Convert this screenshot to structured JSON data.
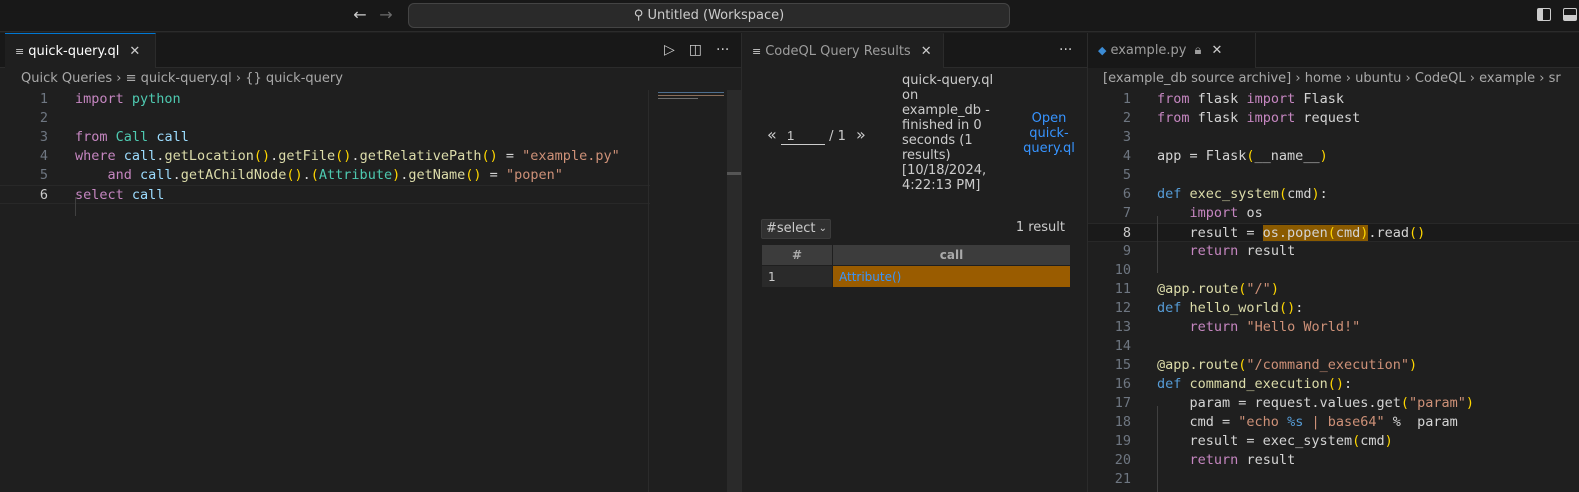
{
  "titlebar": {
    "back_icon": "arrow-left-icon",
    "forward_icon": "arrow-right-icon",
    "search_icon": "search-icon",
    "workspace_title": "Untitled (Workspace)"
  },
  "left_editor": {
    "tab_label": "quick-query.ql",
    "breadcrumb": [
      "Quick Queries",
      "quick-query.ql",
      "{} quick-query"
    ],
    "line_numbers": [
      "1",
      "2",
      "3",
      "4",
      "5",
      "6"
    ],
    "current_line": "6",
    "code_lines": [
      "import python",
      "",
      "from Call call",
      "where call.getLocation().getFile().getRelativePath() = \"example.py\"",
      "    and call.getAChildNode().(Attribute).getName() = \"popen\"",
      "select call"
    ]
  },
  "results_panel": {
    "tab_label": "CodeQL Query Results",
    "page_input": "1",
    "page_total": "/ 1",
    "prev_label": "«",
    "next_label": "»",
    "meta_lines": [
      "quick-query.ql",
      "on",
      "example_db -",
      "finished in 0",
      "seconds (1",
      "results)",
      "[10/18/2024,",
      "4:22:13 PM]"
    ],
    "open_link_lines": [
      "Open",
      "quick-",
      "query.ql"
    ],
    "select_value": "#select",
    "result_count": "1 result",
    "columns": [
      "#",
      "call"
    ],
    "rows": [
      {
        "index": "1",
        "call": "Attribute()"
      }
    ]
  },
  "right_editor": {
    "tab_label": "example.py",
    "breadcrumb": [
      "[example_db source archive]",
      "home",
      "ubuntu",
      "CodeQL",
      "example",
      "sr"
    ],
    "current_line": "8",
    "line_numbers": [
      "1",
      "2",
      "3",
      "4",
      "5",
      "6",
      "7",
      "8",
      "9",
      "10",
      "11",
      "12",
      "13",
      "14",
      "15",
      "16",
      "17",
      "18",
      "19",
      "20",
      "21"
    ],
    "code_lines": [
      "from flask import Flask",
      "from flask import request",
      "",
      "app = Flask(__name__)",
      "",
      "def exec_system(cmd):",
      "    import os",
      "    result = os.popen(cmd).read()",
      "    return result",
      "",
      "@app.route(\"/\")",
      "def hello_world():",
      "    return \"Hello World!\"",
      "",
      "@app.route(\"/command_execution\")",
      "def command_execution():",
      "    param = request.values.get(\"param\")",
      "    cmd = \"echo %s | base64\" %  param",
      "    result = exec_system(cmd)",
      "    return result",
      ""
    ]
  }
}
